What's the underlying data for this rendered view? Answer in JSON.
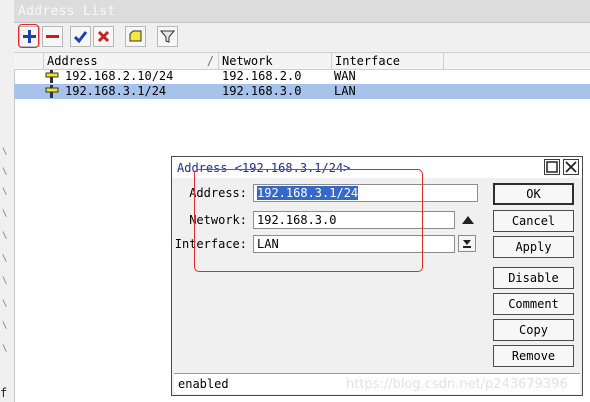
{
  "address_list": {
    "title": "Address List",
    "toolbar": {
      "add": "add-icon",
      "remove": "remove-icon",
      "enable": "check-icon",
      "disable": "x-icon",
      "comment": "comment-icon",
      "filter": "filter-icon"
    },
    "columns": [
      "Address",
      "Network",
      "Interface"
    ],
    "sort_indicator": "/",
    "rows": [
      {
        "address": "192.168.2.10/24",
        "network": "192.168.2.0",
        "interface": "WAN",
        "selected": false
      },
      {
        "address": "192.168.3.1/24",
        "network": "192.168.3.0",
        "interface": "LAN",
        "selected": true
      }
    ]
  },
  "left_strip": {
    "char": "f"
  },
  "dialog": {
    "title": "Address <192.168.3.1/24>",
    "fields": {
      "address_label": "Address:",
      "address_value": "192.168.3.1/24",
      "network_label": "Network:",
      "network_value": "192.168.3.0",
      "interface_label": "Interface:",
      "interface_value": "LAN"
    },
    "buttons": {
      "ok": "OK",
      "cancel": "Cancel",
      "apply": "Apply",
      "disable": "Disable",
      "comment": "Comment",
      "copy": "Copy",
      "remove": "Remove"
    },
    "status": "enabled",
    "watermark": "https://blog.csdn.net/p243679396"
  },
  "colors": {
    "selection": "#a5c3eb",
    "highlight_box": "#e12a2a",
    "title_text": "#1f2e8a"
  }
}
